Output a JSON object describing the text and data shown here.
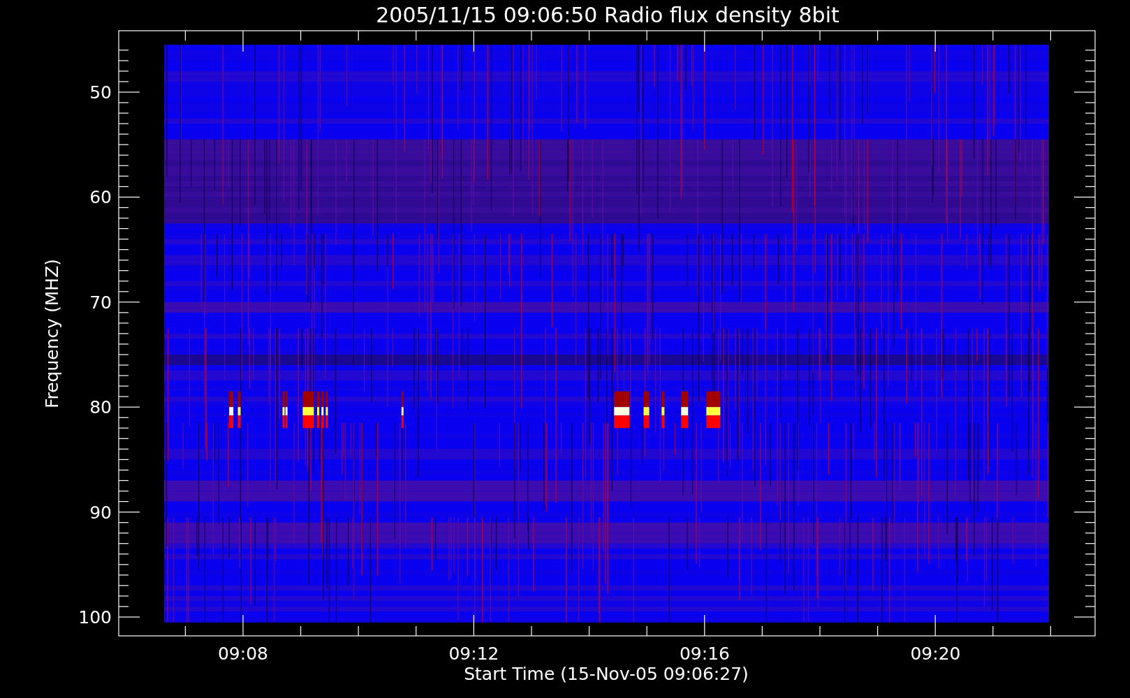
{
  "title": "2005/11/15 09:06:50 Radio flux density 8bit",
  "y_axis": {
    "label": "Frequency (MHZ)",
    "ticks": [
      "50",
      "60",
      "70",
      "80",
      "90",
      "100"
    ]
  },
  "x_axis": {
    "label": "Start Time (15-Nov-05 09:06:27)",
    "ticks": [
      "09:08",
      "09:12",
      "09:16",
      "09:20"
    ]
  }
}
